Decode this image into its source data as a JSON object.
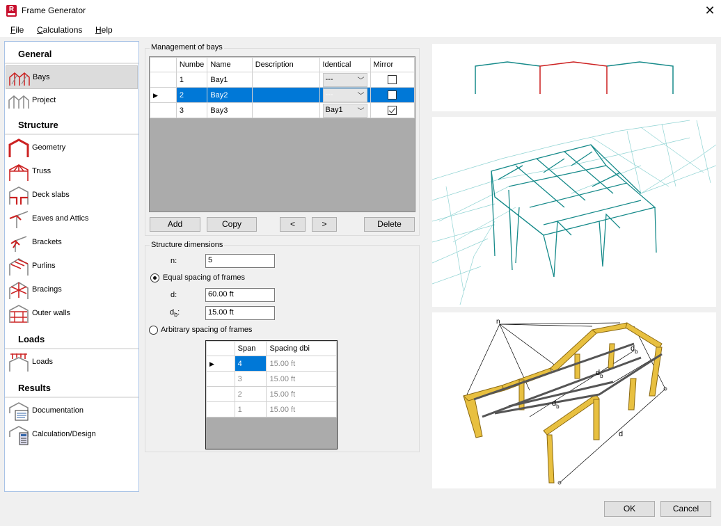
{
  "window": {
    "title": "Frame Generator",
    "icon_letter": "R",
    "close_glyph": "✕"
  },
  "menu": [
    {
      "label": "File",
      "accel": "F",
      "rest": "ile"
    },
    {
      "label": "Calculations",
      "accel": "C",
      "rest": "alculations"
    },
    {
      "label": "Help",
      "accel": "H",
      "rest": "elp"
    }
  ],
  "nav": {
    "general": "General",
    "bays": "Bays",
    "project": "Project",
    "structure": "Structure",
    "geometry": "Geometry",
    "truss": "Truss",
    "deck_slabs": "Deck slabs",
    "eaves": "Eaves and Attics",
    "brackets": "Brackets",
    "purlins": "Purlins",
    "bracings": "Bracings",
    "outer_walls": "Outer walls",
    "loads_head": "Loads",
    "loads": "Loads",
    "results": "Results",
    "documentation": "Documentation",
    "calculation": "Calculation/Design"
  },
  "bays": {
    "group_title": "Management of bays",
    "columns": {
      "number": "Numbe",
      "name": "Name",
      "description": "Description",
      "identical": "Identical",
      "mirror": "Mirror"
    },
    "rows": [
      {
        "number": "1",
        "name": "Bay1",
        "description": "",
        "identical": "---",
        "mirror": false,
        "selected": false
      },
      {
        "number": "2",
        "name": "Bay2",
        "description": "",
        "identical": "---",
        "mirror": false,
        "selected": true
      },
      {
        "number": "3",
        "name": "Bay3",
        "description": "",
        "identical": "Bay1",
        "mirror": true,
        "selected": false
      }
    ],
    "buttons": {
      "add": "Add",
      "copy": "Copy",
      "prev": "<",
      "next": ">",
      "delete": "Delete"
    }
  },
  "structure": {
    "group_title": "Structure dimensions",
    "n_label": "n:",
    "n_value": "5",
    "equal_label": "Equal spacing of frames",
    "equal_selected": true,
    "d_label": "d:",
    "d_value": "60.00 ft",
    "db_label_main": "d",
    "db_label_sub": "b",
    "db_label_colon": ":",
    "db_value": "15.00 ft",
    "arbitrary_label": "Arbitrary spacing of frames",
    "span_columns": {
      "span": "Span",
      "spacing": "Spacing dbi"
    },
    "spans": [
      {
        "span": "4",
        "spacing": "15.00 ft"
      },
      {
        "span": "3",
        "spacing": "15.00 ft"
      },
      {
        "span": "2",
        "spacing": "15.00 ft"
      },
      {
        "span": "1",
        "spacing": "15.00 ft"
      }
    ]
  },
  "diagram": {
    "n_label": "n",
    "db_main": "d",
    "db_sub": "b",
    "d_label": "d"
  },
  "footer": {
    "ok": "OK",
    "cancel": "Cancel"
  },
  "colors": {
    "selection": "#0078d7",
    "teal": "#168a8a",
    "red": "#cc1f1f",
    "beam_yellow": "#e8c040"
  }
}
